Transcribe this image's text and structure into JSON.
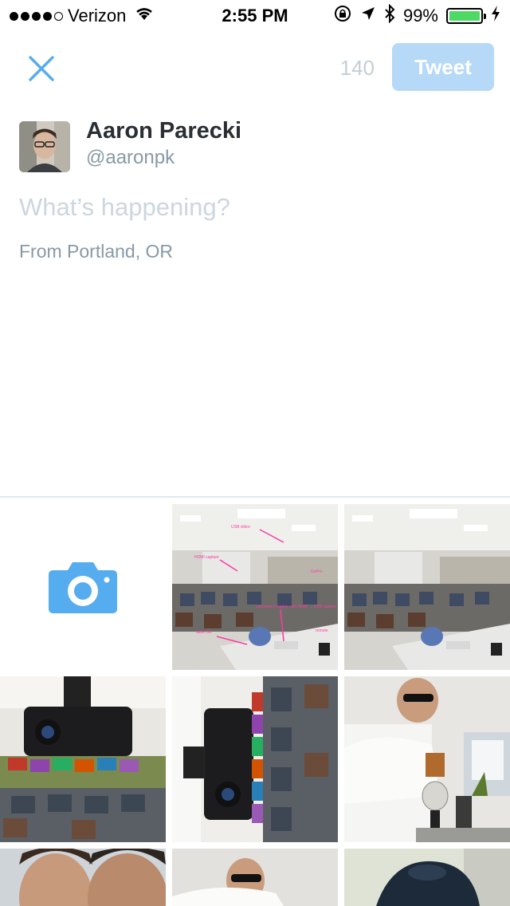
{
  "status_bar": {
    "carrier": "Verizon",
    "time": "2:55 PM",
    "battery": "99%",
    "battery_level": 0.99
  },
  "header": {
    "char_count": "140",
    "tweet_label": "Tweet"
  },
  "user": {
    "name": "Aaron Parecki",
    "handle": "@aaronpk"
  },
  "composer": {
    "placeholder": "What’s happening?",
    "location": "From Portland, OR"
  },
  "annotations": {
    "usb_video": "USB video",
    "hdmi": "HDMI capture",
    "gopro": "GoPro",
    "presenter": "presenter's laptop with HDMI → USB capture",
    "table": "table mic",
    "remote": "remote"
  },
  "colors": {
    "accent": "#55acee",
    "tweet_disabled": "#b5d9f7"
  }
}
